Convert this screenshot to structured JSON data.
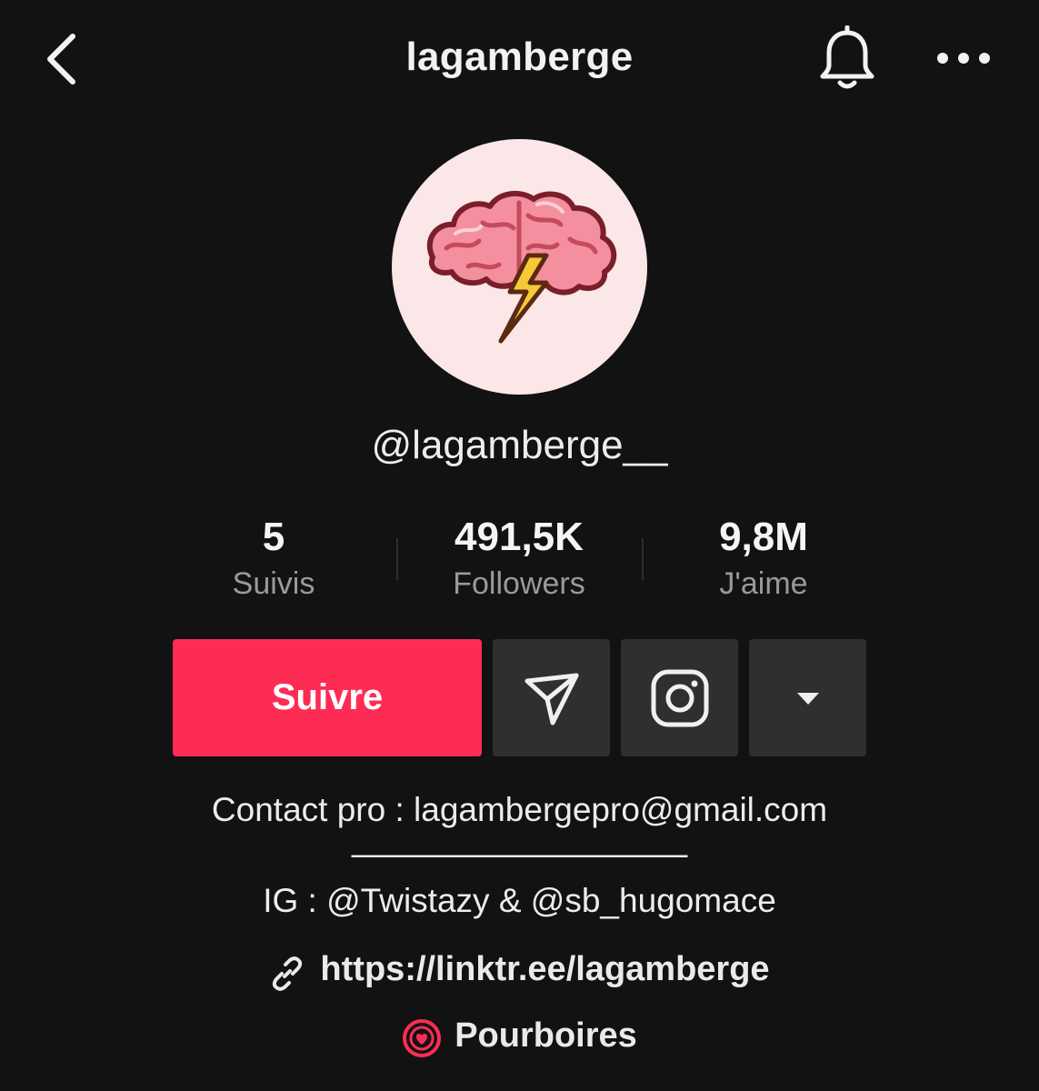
{
  "header": {
    "title": "lagamberge",
    "back_icon": "chevron-left-icon",
    "bell_icon": "bell-icon",
    "more_icon": "more-horizontal-icon"
  },
  "profile": {
    "avatar_icon": "brain-lightning-logo",
    "handle": "@lagamberge__"
  },
  "stats": [
    {
      "value": "5",
      "label": "Suivis"
    },
    {
      "value": "491,5K",
      "label": "Followers"
    },
    {
      "value": "9,8M",
      "label": "J'aime"
    }
  ],
  "actions": {
    "follow_label": "Suivre",
    "message_icon": "send-icon",
    "instagram_icon": "instagram-icon",
    "more_icon": "caret-down-icon"
  },
  "bio": {
    "line1": "Contact pro : lagambergepro@gmail.com",
    "line2": "——————————",
    "line3": "IG : @Twistazy & @sb_hugomace",
    "link": "https://linktr.ee/lagamberge",
    "link_icon": "link-icon",
    "tips": "Pourboires",
    "tips_icon": "tips-heart-icon"
  },
  "colors": {
    "background": "#121212",
    "accent": "#fe2c55",
    "secondary_button": "#2f2f2f",
    "muted_text": "#9a9a9a",
    "avatar_bg": "#fbe6e8"
  }
}
